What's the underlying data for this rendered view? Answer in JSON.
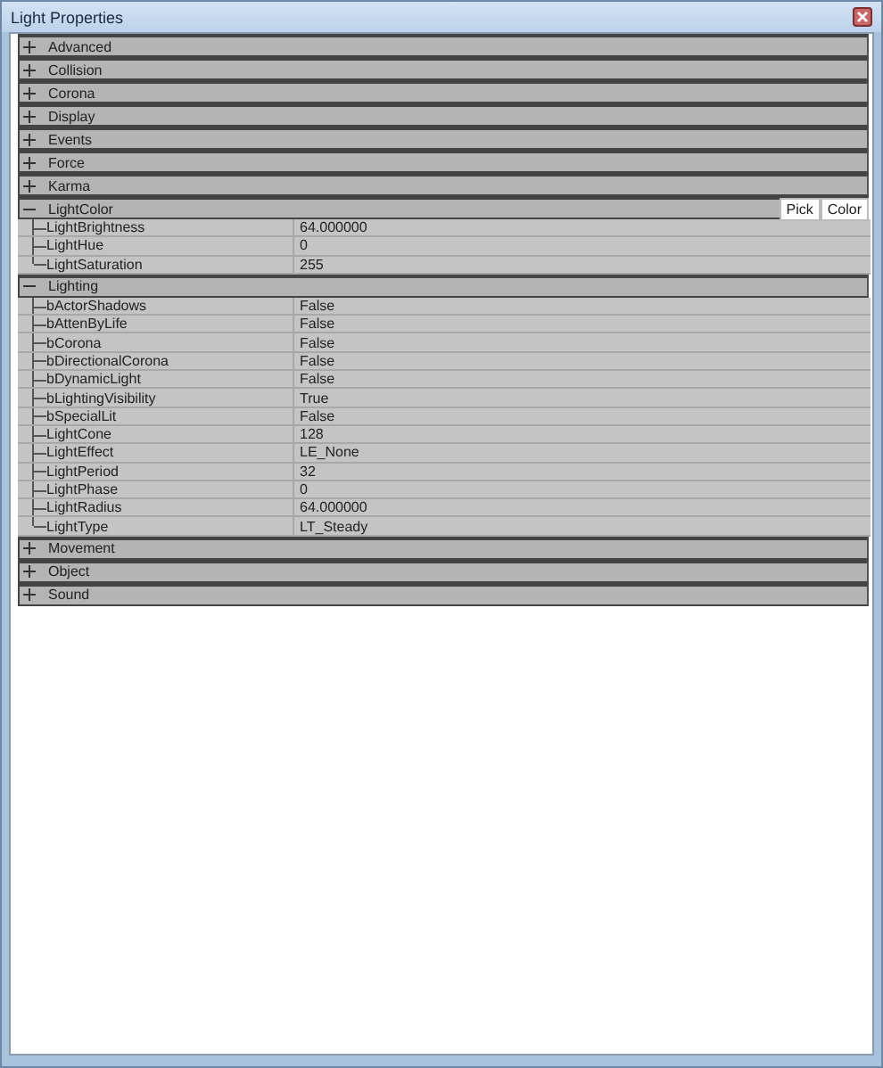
{
  "window": {
    "title": "Light Properties"
  },
  "categories": [
    {
      "name": "Advanced",
      "expanded": false
    },
    {
      "name": "Collision",
      "expanded": false
    },
    {
      "name": "Corona",
      "expanded": false
    },
    {
      "name": "Display",
      "expanded": false
    },
    {
      "name": "Events",
      "expanded": false
    },
    {
      "name": "Force",
      "expanded": false
    },
    {
      "name": "Karma",
      "expanded": false
    },
    {
      "name": "LightColor",
      "expanded": true,
      "buttons": [
        "Pick",
        "Color"
      ],
      "properties": [
        {
          "name": "LightBrightness",
          "value": "64.000000"
        },
        {
          "name": "LightHue",
          "value": "0"
        },
        {
          "name": "LightSaturation",
          "value": "255"
        }
      ]
    },
    {
      "name": "Lighting",
      "expanded": true,
      "properties": [
        {
          "name": "bActorShadows",
          "value": "False"
        },
        {
          "name": "bAttenByLife",
          "value": "False"
        },
        {
          "name": "bCorona",
          "value": "False"
        },
        {
          "name": "bDirectionalCorona",
          "value": "False"
        },
        {
          "name": "bDynamicLight",
          "value": "False"
        },
        {
          "name": "bLightingVisibility",
          "value": "True"
        },
        {
          "name": "bSpecialLit",
          "value": "False"
        },
        {
          "name": "LightCone",
          "value": "128"
        },
        {
          "name": "LightEffect",
          "value": "LE_None"
        },
        {
          "name": "LightPeriod",
          "value": "32"
        },
        {
          "name": "LightPhase",
          "value": "0"
        },
        {
          "name": "LightRadius",
          "value": "64.000000"
        },
        {
          "name": "LightType",
          "value": "LT_Steady"
        }
      ]
    },
    {
      "name": "Movement",
      "expanded": false
    },
    {
      "name": "Object",
      "expanded": false
    },
    {
      "name": "Sound",
      "expanded": false
    }
  ]
}
